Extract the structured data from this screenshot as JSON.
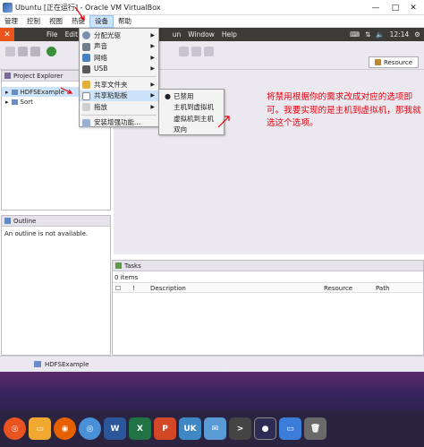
{
  "window": {
    "title": "Ubuntu [正在运行] - Oracle VM VirtualBox",
    "minimize": "—",
    "maximize": "□",
    "close": "✕"
  },
  "vbox_menu": [
    "管理",
    "控制",
    "视图",
    "热键",
    "设备",
    "帮助"
  ],
  "vbox_menu_active": "设备",
  "ubuntu_bar": {
    "menus": [
      "File",
      "Edit",
      "N",
      "un",
      "Window",
      "Help"
    ],
    "clock": "12:14"
  },
  "devices_menu": {
    "items": [
      {
        "label": "分配光驱",
        "submenu": true
      },
      {
        "label": "声音",
        "submenu": true
      },
      {
        "label": "网络",
        "submenu": true
      },
      {
        "label": "USB",
        "submenu": true
      },
      {
        "label": "共享文件夹",
        "submenu": true
      },
      {
        "label": "共享粘贴板",
        "submenu": true,
        "highlighted": true
      },
      {
        "label": "拖放",
        "submenu": true
      },
      {
        "label": "安装增强功能...",
        "submenu": false
      }
    ]
  },
  "clipboard_submenu": {
    "items": [
      {
        "label": "已禁用",
        "checked": true
      },
      {
        "label": "主机到虚拟机",
        "checked": false
      },
      {
        "label": "虚拟机到主机",
        "checked": false
      },
      {
        "label": "双向",
        "checked": false
      }
    ]
  },
  "annotation": "将禁用根据你的需求改成对应的选项即可。我要实现的是主机到虚拟机，那我就选这个选项。",
  "eclipse": {
    "resource_button": "Resource",
    "project_explorer": {
      "title": "Project Explorer",
      "items": [
        "HDFSExample",
        "Sort"
      ]
    },
    "outline": {
      "title": "Outline",
      "message": "An outline is not available."
    },
    "tasks": {
      "title": "Tasks",
      "count": "0 items",
      "columns": [
        "!",
        "Description",
        "Resource",
        "Path"
      ]
    },
    "status": "HDFSExample"
  },
  "dock_icons": [
    "ubuntu-logo-icon",
    "files-icon",
    "firefox-icon",
    "chromium-icon",
    "word-icon",
    "excel-icon",
    "powerpoint-icon",
    "uk-icon",
    "mail-icon",
    "terminal-icon",
    "eclipse-icon",
    "folder-icon",
    "trash-icon"
  ],
  "colors": {
    "accent": "#e8000b",
    "menu_highlight": "#cde3fa",
    "ubuntu_orange": "#e9541c"
  }
}
